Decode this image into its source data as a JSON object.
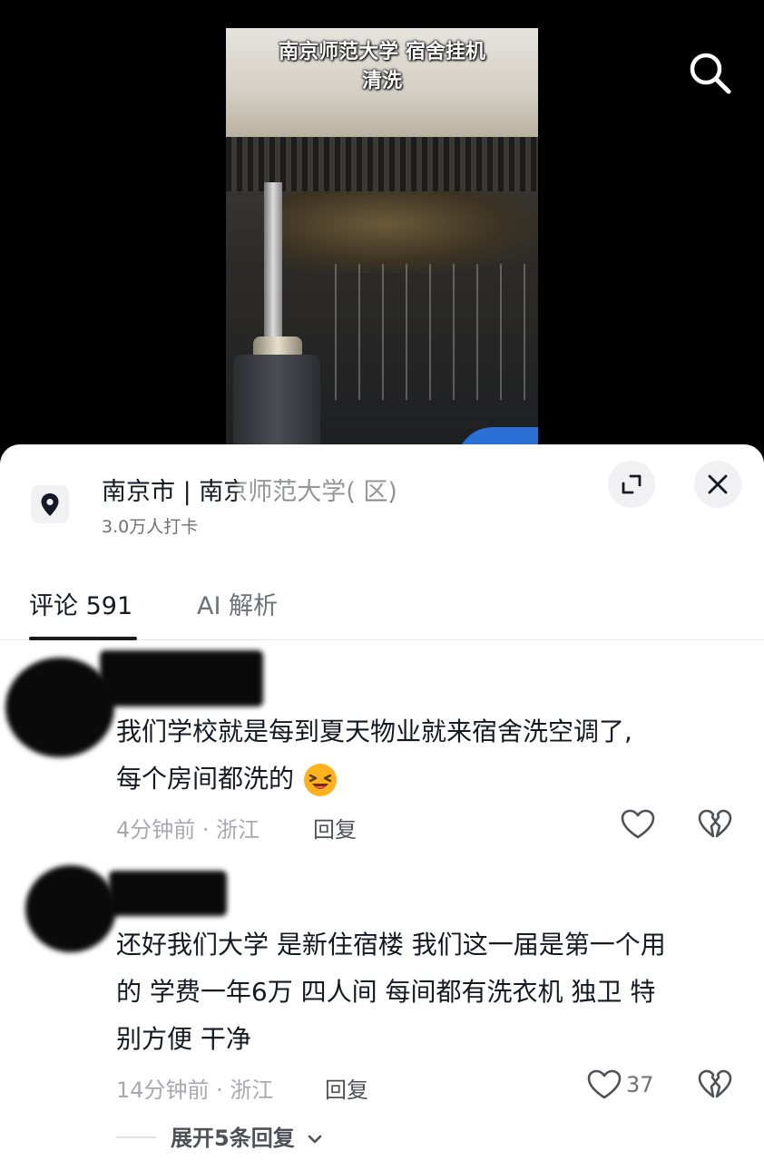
{
  "video": {
    "caption_line1": "南京师范大学 宿舍挂机",
    "caption_line2": "清洗"
  },
  "location": {
    "title": "南京市 | 南京师范大学(    区)",
    "checkins": "3.0万人打卡"
  },
  "tabs": {
    "comments_label": "评论 591",
    "ai_label": "AI 解析"
  },
  "comments": [
    {
      "text_line1": "我们学校就是每到夏天物业就来宿舍洗空调了,",
      "text_line2": "每个房间都洗的",
      "emoji": "laughing-crying-emoji",
      "meta": "4分钟前 · 浙江",
      "reply_label": "回复",
      "likes": ""
    },
    {
      "text_line1": "还好我们大学 是新住宿楼 我们这一届是第一个用",
      "text_line2": "的 学费一年6万 四人间 每间都有洗衣机 独卫 特",
      "text_line3": "别方便 干净",
      "meta": "14分钟前 · 浙江",
      "reply_label": "回复",
      "likes": "37"
    }
  ],
  "expand_replies_label": "展开5条回复",
  "colors": {
    "text_primary": "#161823",
    "text_secondary": "#6f7078",
    "text_meta": "#a8a9ae",
    "sheet_bg": "#ffffff",
    "button_bg": "#f1f1f3"
  }
}
